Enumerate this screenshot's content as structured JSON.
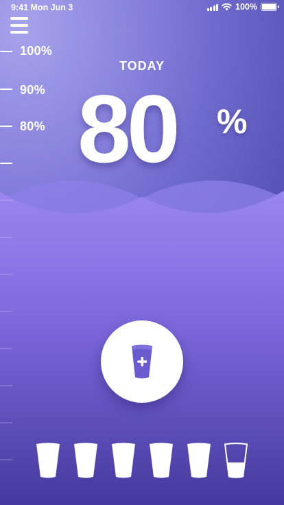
{
  "status_bar": {
    "time": "9:41 Mon Jun 3",
    "battery": "100%",
    "icons": [
      "signal-icon",
      "wifi-icon",
      "battery-icon"
    ]
  },
  "menu": {
    "icon": "menu-icon"
  },
  "scale": {
    "labels": [
      "100%",
      "90%",
      "80%"
    ]
  },
  "today": {
    "title": "TODAY",
    "value": "80",
    "unit": "%",
    "fill_fraction": 0.8
  },
  "add_button": {
    "icon": "add-water-glass-icon"
  },
  "cups": {
    "total": 6,
    "full": 5,
    "last_fill_fraction": 0.4
  },
  "colors": {
    "background_top": "#a6a3ec",
    "background_mid": "#6f6acd",
    "water_surface": "#9882ef",
    "water_bottom": "#4a3aa0",
    "accent": "#6a5bd0",
    "white": "#ffffff"
  }
}
